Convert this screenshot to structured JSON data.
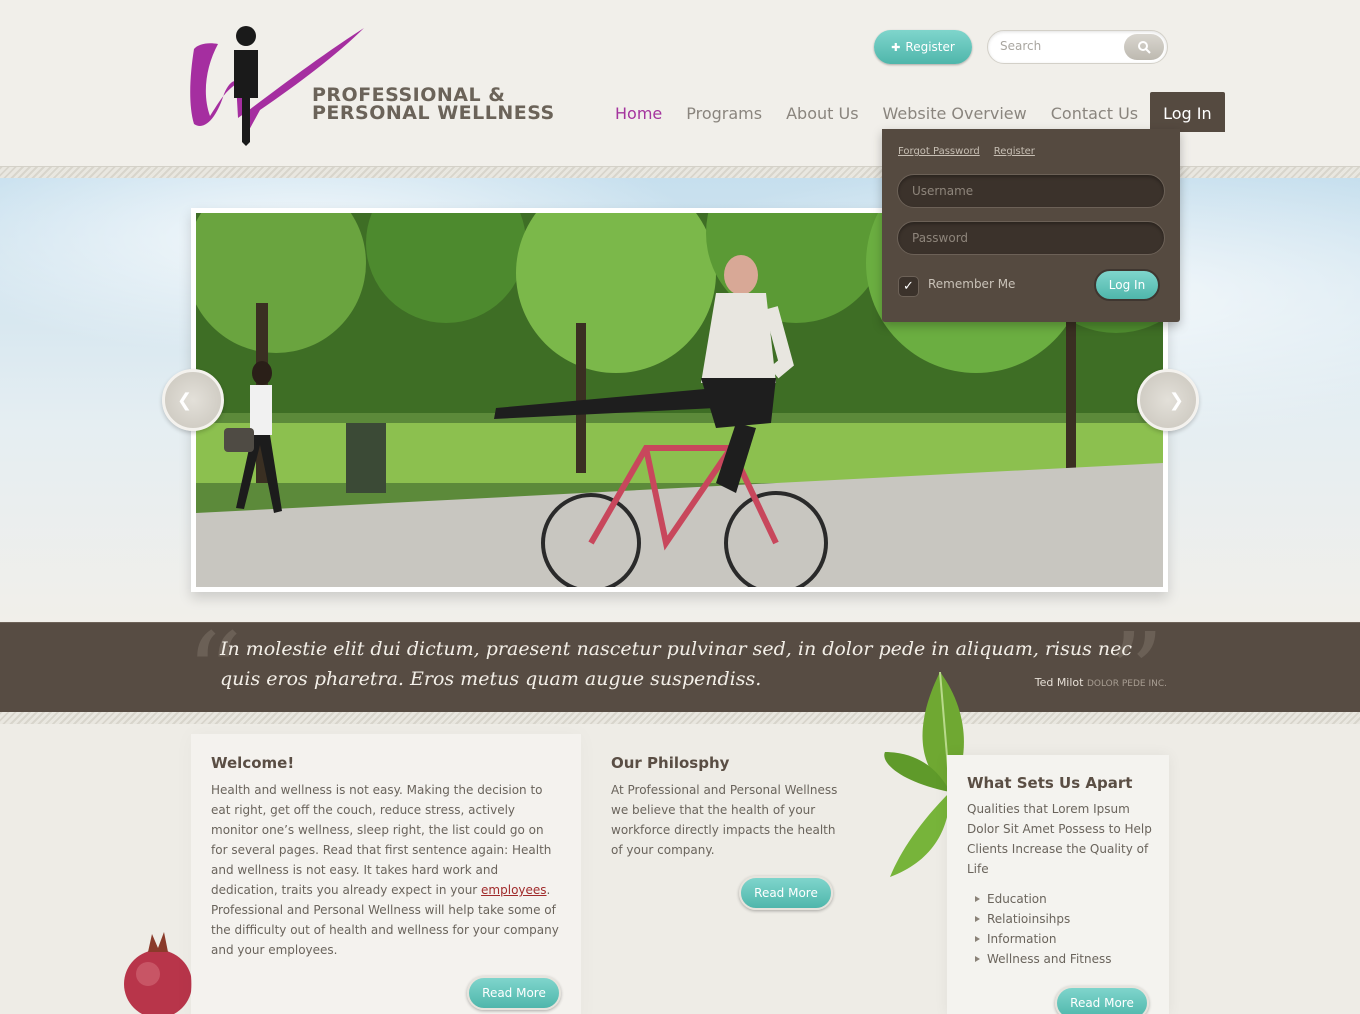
{
  "logo": {
    "line1": "PROFESSIONAL &",
    "line2": "PERSONAL WELLNESS"
  },
  "header": {
    "register_label": "Register",
    "search_placeholder": "Search"
  },
  "nav": {
    "items": [
      {
        "label": "Home",
        "active": true
      },
      {
        "label": "Programs"
      },
      {
        "label": "About Us"
      },
      {
        "label": "Website Overview"
      },
      {
        "label": "Contact Us"
      },
      {
        "label": "Log In"
      }
    ]
  },
  "login": {
    "forgot_label": "Forgot Password",
    "register_label": "Register",
    "username_placeholder": "Username",
    "password_placeholder": "Password",
    "remember_label": "Remember Me",
    "remember_checked": true,
    "submit_label": "Log In"
  },
  "quote": {
    "text": "In molestie elit dui dictum, praesent nascetur pulvinar sed, in dolor pede in aliquam, risus nec quis eros pharetra. Eros metus quam augue suspendiss.",
    "author": "Ted Milot",
    "company": "DOLOR PEDE INC."
  },
  "welcome": {
    "title": "Welcome!",
    "text_before": "Health and wellness is not easy. Making the decision to eat right, get off the couch, reduce stress, actively monitor one’s wellness, sleep right, the list could go on for several pages. Read that first sentence again: Health and wellness is not easy. It takes hard work and dedication, traits you already expect in your ",
    "link": "employees",
    "text_after": ". Professional and Personal Wellness will help take some of the difficulty out of health and wellness for your company and your employees.",
    "button": "Read More"
  },
  "philosophy": {
    "title": "Our Philosphy",
    "text": "At Professional and Personal Wellness we believe that the health of your workforce directly impacts the health of your company.",
    "button": "Read More"
  },
  "apart": {
    "title": "What Sets Us Apart",
    "text": "Qualities that Lorem Ipsum Dolor Sit Amet Possess to Help Clients Increase the Quality of Life",
    "items": [
      "Education",
      "Relatioinsihps",
      "Information",
      "Wellness and Fitness"
    ],
    "button": "Read More"
  },
  "colors": {
    "accent_teal": "#5cc2b7",
    "brand_magenta": "#a4349e",
    "dark_brown": "#554a40"
  }
}
